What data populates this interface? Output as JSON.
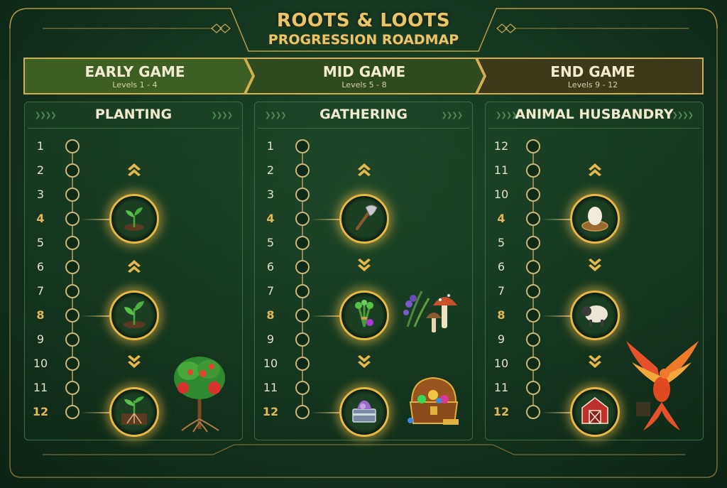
{
  "title": {
    "main": "ROOTS & LOOTS",
    "sub": "PROGRESSION ROADMAP"
  },
  "phases": [
    {
      "label": "EARLY GAME",
      "levels": "Levels 1 - 4"
    },
    {
      "label": "MID GAME",
      "levels": "Levels 5 - 8"
    },
    {
      "label": "END GAME",
      "levels": "Levels 9 - 12"
    }
  ],
  "panels": [
    {
      "title": "PLANTING",
      "levels": [
        "1",
        "2",
        "3",
        "4",
        "5",
        "6",
        "7",
        "8",
        "9",
        "10",
        "11",
        "12"
      ],
      "milestones": [
        {
          "icon": "seedling-sprout-icon"
        },
        {
          "icon": "young-plant-icon"
        },
        {
          "icon": "rooted-plant-icon"
        }
      ],
      "chevrons": [
        "up-chevron-icon",
        "up-chevron-icon",
        "down-chevron-icon"
      ],
      "reward_icon": "tomato-tree-icon"
    },
    {
      "title": "GATHERING",
      "levels": [
        "1",
        "2",
        "3",
        "4",
        "5",
        "6",
        "7",
        "8",
        "9",
        "10",
        "11",
        "12"
      ],
      "milestones": [
        {
          "icon": "axe-icon"
        },
        {
          "icon": "herb-bundle-icon"
        },
        {
          "icon": "storage-crate-icon"
        }
      ],
      "chevrons": [
        "up-chevron-icon",
        "down-chevron-icon",
        "down-chevron-icon"
      ],
      "reward_icons": [
        "herbs-and-mushrooms-icon",
        "treasure-chest-icon"
      ]
    },
    {
      "title": "ANIMAL HUSBANDRY",
      "levels": [
        "12",
        "11",
        "10",
        "4",
        "5",
        "6",
        "7",
        "8",
        "9",
        "10",
        "11",
        "12"
      ],
      "milestones": [
        {
          "icon": "egg-in-nest-icon"
        },
        {
          "icon": "sheep-icon"
        },
        {
          "icon": "barn-icon"
        }
      ],
      "chevrons": [
        "up-chevron-icon",
        "down-chevron-icon",
        "down-chevron-icon"
      ],
      "reward_icon": "phoenix-icon"
    }
  ],
  "colors": {
    "gold": "#e6b84a",
    "background": "#14331e",
    "highlight_level": "#e3b85a"
  }
}
